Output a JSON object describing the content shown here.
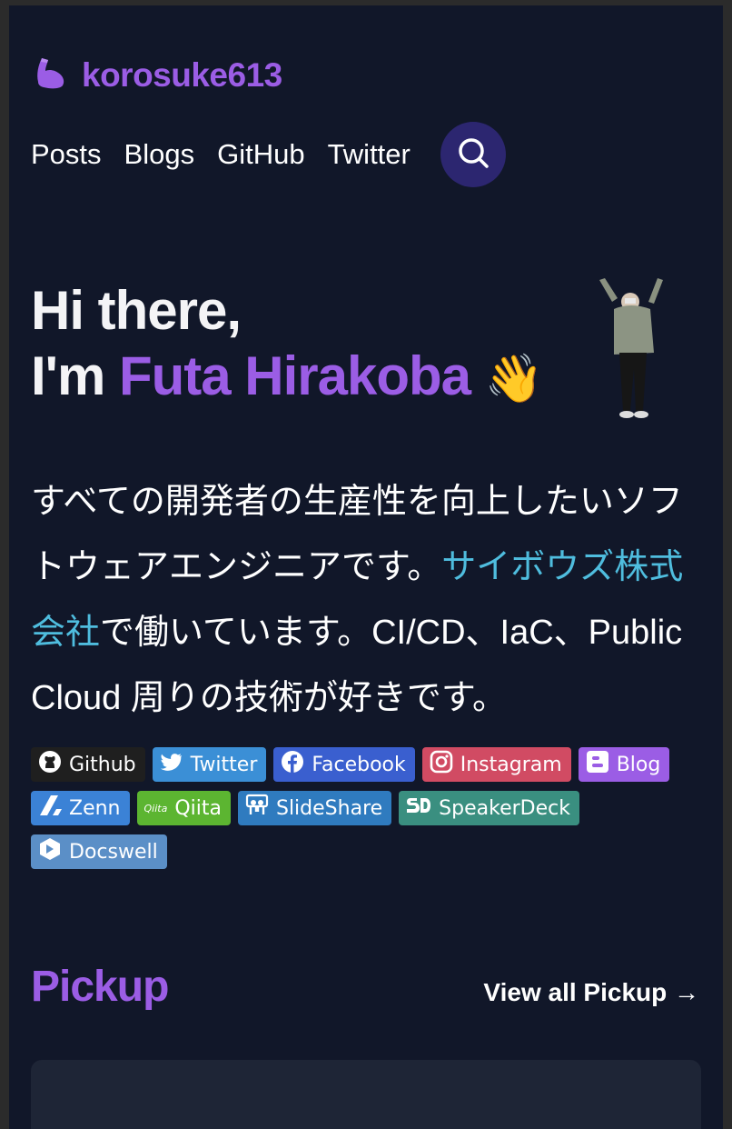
{
  "site": {
    "logo_text": "korosuke613",
    "logo_icon": "flexed-biceps-icon",
    "brand_color": "#9b5de5"
  },
  "nav": {
    "items": [
      {
        "label": "Posts"
      },
      {
        "label": "Blogs"
      },
      {
        "label": "GitHub"
      },
      {
        "label": "Twitter"
      }
    ],
    "search_icon": "search-icon"
  },
  "hero": {
    "line1": "Hi there,",
    "line2_prefix": "I'm ",
    "name": "Futa Hirakoba",
    "wave": "👋"
  },
  "bio": {
    "text_before": "すべての開発者の生産性を向上したいソフトウェアエンジニアです。",
    "company": "サイボウズ株式会社",
    "text_after": "で働いています。CI/CD、IaC、Public Cloud 周りの技術が好きです。",
    "link_color": "#4fbdde"
  },
  "badges": [
    {
      "label": "Github",
      "icon": "github-icon",
      "color": "#1f1f1f"
    },
    {
      "label": "Twitter",
      "icon": "twitter-icon",
      "color": "#3b8fd6"
    },
    {
      "label": "Facebook",
      "icon": "facebook-icon",
      "color": "#3a5fcf"
    },
    {
      "label": "Instagram",
      "icon": "instagram-icon",
      "color": "#d14b63"
    },
    {
      "label": "Blog",
      "icon": "blogger-icon",
      "color": "#9b5de5"
    },
    {
      "label": "Zenn",
      "icon": "zenn-icon",
      "color": "#3b82d6"
    },
    {
      "label": "Qiita",
      "icon": "qiita-icon",
      "color": "#5cb531"
    },
    {
      "label": "SlideShare",
      "icon": "slideshare-icon",
      "color": "#2f7bbf"
    },
    {
      "label": "SpeakerDeck",
      "icon": "speakerdeck-icon",
      "color": "#3a8f80"
    },
    {
      "label": "Docswell",
      "icon": "docswell-icon",
      "color": "#5b8fc7"
    }
  ],
  "pickup": {
    "title": "Pickup",
    "view_all": "View all Pickup →"
  }
}
